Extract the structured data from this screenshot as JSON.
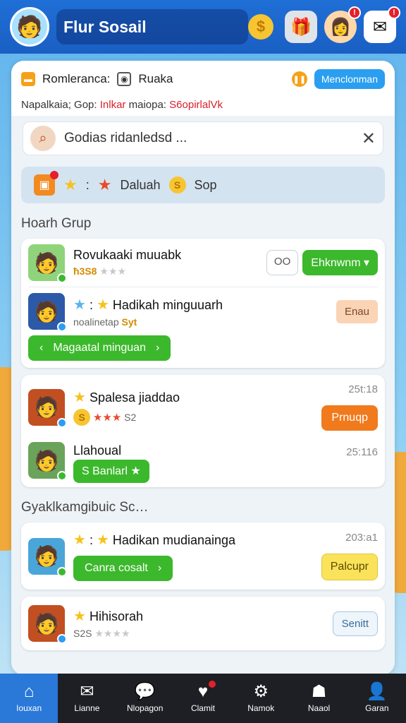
{
  "header": {
    "title": "Flur Sosail",
    "icons": [
      "avatar",
      "coin-icon",
      "gift-icon",
      "friend-icon",
      "message-icon"
    ]
  },
  "info": {
    "label1": "Romlerancа:",
    "label2": "Ruaka",
    "button": "Menclonman",
    "line2_prefix": "Napalkaia; Gop:",
    "line2_red1": "Inlkar",
    "line2_mid": "maiopa:",
    "line2_red2": "S6opirlalVk"
  },
  "search": {
    "value": "Godias ridanledsd ..."
  },
  "reward_strip": {
    "text1": "Daluah",
    "text2": "Sop"
  },
  "sections": {
    "group_title": "Hoarh Grup",
    "second_title": "Gyaklkamgibuic Sc…"
  },
  "rows": [
    {
      "name": "Rovukaaki muuabk",
      "sub": "ħ3S8",
      "btn1": "OO",
      "btn2": "Ehknwnm ▾"
    },
    {
      "name": "Hadikah minguuarh",
      "sub": "noalinetap",
      "sub_badge": "Syt",
      "btn": "Enau",
      "wide": "Magaatal minguan"
    },
    {
      "name": "Spalesa jiaddao",
      "sub": "S2",
      "time": "25t:18",
      "btn": "Prnuqp"
    },
    {
      "name": "Llahoual",
      "time": "25:116",
      "pill": "S  Banlarl ★"
    },
    {
      "name": "Hadikan mudianainga",
      "time": "203:a1",
      "wide": "Canra cosalt",
      "btn": "Palcupr"
    },
    {
      "name": "Hihisorah",
      "sub": "S2S",
      "btn": "Senitt"
    }
  ],
  "nav": [
    {
      "label": "Iouxan",
      "icon": "home-icon"
    },
    {
      "label": "Lianne",
      "icon": "mail-icon"
    },
    {
      "label": "Nlopagon",
      "icon": "chat-icon"
    },
    {
      "label": "Clamit",
      "icon": "heart-icon"
    },
    {
      "label": "Namok",
      "icon": "gear-icon"
    },
    {
      "label": "Naaol",
      "icon": "game-icon"
    },
    {
      "label": "Garan",
      "icon": "profile-icon"
    }
  ]
}
